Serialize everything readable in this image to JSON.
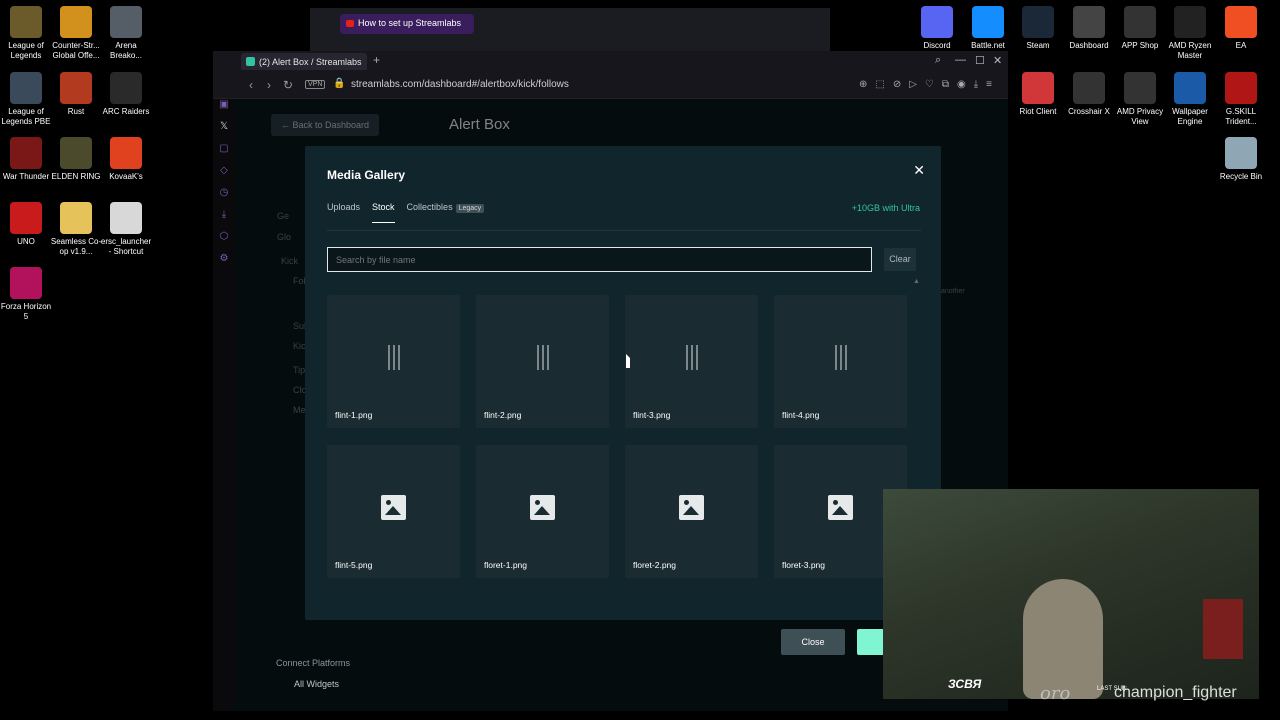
{
  "desktop_left": [
    {
      "label": "League of Legends",
      "color": "#6b5a2a"
    },
    {
      "label": "Counter-Str... Global Offe...",
      "color": "#d2901c"
    },
    {
      "label": "Arena Breako...",
      "color": "#555d66"
    },
    {
      "label": "League of Legends PBE",
      "color": "#3b4a5a"
    },
    {
      "label": "Rust",
      "color": "#b13a1f"
    },
    {
      "label": "ARC Raiders",
      "color": "#2a2a2a"
    },
    {
      "label": "War Thunder",
      "color": "#7a1818"
    },
    {
      "label": "ELDEN RING",
      "color": "#4c4a2c"
    },
    {
      "label": "KovaaK's",
      "color": "#e0421f"
    },
    {
      "label": "UNO",
      "color": "#c91b1b"
    },
    {
      "label": "Seamless Co-op v1.9...",
      "color": "#e5c25a"
    },
    {
      "label": "ersc_launcher - Shortcut",
      "color": "#d8d8d8"
    },
    {
      "label": "Forza Horizon 5",
      "color": "#b2115c"
    }
  ],
  "desktop_right": [
    {
      "label": "Discord",
      "color": "#5865f2"
    },
    {
      "label": "Battle.net",
      "color": "#148eff"
    },
    {
      "label": "Steam",
      "color": "#1b2838"
    },
    {
      "label": "Dashboard",
      "color": "#444"
    },
    {
      "label": "APP Shop",
      "color": "#333"
    },
    {
      "label": "AMD Ryzen Master",
      "color": "#222"
    },
    {
      "label": "EA",
      "color": "#f04e23"
    },
    {
      "label": "Riot Client",
      "color": "#d13639"
    },
    {
      "label": "Crosshair X",
      "color": "#333"
    },
    {
      "label": "AMD Privacy View",
      "color": "#333"
    },
    {
      "label": "Wallpaper Engine",
      "color": "#1a5aa6"
    },
    {
      "label": "G.SKILL Trident...",
      "color": "#b11616"
    },
    {
      "label": "Recycle Bin",
      "color": "#8fa6b5"
    }
  ],
  "bg_browser": {
    "tab_label": "How to set up Streamlabs"
  },
  "browser": {
    "tab_label": "(2) Alert Box / Streamlabs",
    "vpn": "VPN",
    "url": "streamlabs.com/dashboard#/alertbox/kick/follows"
  },
  "page": {
    "back_label": "Back to Dashboard",
    "title": "Alert Box",
    "side_items": [
      "Ge",
      "Glo",
      "Kick",
      "Fol",
      "Sub",
      "Kic",
      "Tip",
      "Clo",
      "Me"
    ],
    "right_hint": "another",
    "connect_label": "Connect Platforms",
    "all_widgets": "All Widgets"
  },
  "modal": {
    "title": "Media Gallery",
    "close_icon": "✕",
    "tabs": [
      {
        "label": "Uploads",
        "active": false
      },
      {
        "label": "Stock",
        "active": true
      },
      {
        "label": "Collectibles",
        "active": false
      }
    ],
    "legacy_badge": "Legacy",
    "ultra_link": "+10GB with Ultra",
    "search_placeholder": "Search by file name",
    "clear_label": "Clear",
    "items": [
      {
        "name": "flint-1.png",
        "icon": "sound-bars-icon"
      },
      {
        "name": "flint-2.png",
        "icon": "sound-bars-icon"
      },
      {
        "name": "flint-3.png",
        "icon": "sound-bars-icon"
      },
      {
        "name": "flint-4.png",
        "icon": "sound-bars-icon"
      },
      {
        "name": "flint-5.png",
        "icon": "image-icon"
      },
      {
        "name": "floret-1.png",
        "icon": "image-icon"
      },
      {
        "name": "floret-2.png",
        "icon": "image-icon"
      },
      {
        "name": "floret-3.png",
        "icon": "image-icon"
      }
    ],
    "close_button": "Close"
  },
  "stream_overlay": {
    "logo": "ЗСВЯ",
    "handle": "oro",
    "last_sub_label": "LAST SUB:",
    "last_sub_name": "champion_fighter"
  },
  "colors": {
    "accent": "#31c3a2",
    "select_button": "#80f5d2"
  }
}
